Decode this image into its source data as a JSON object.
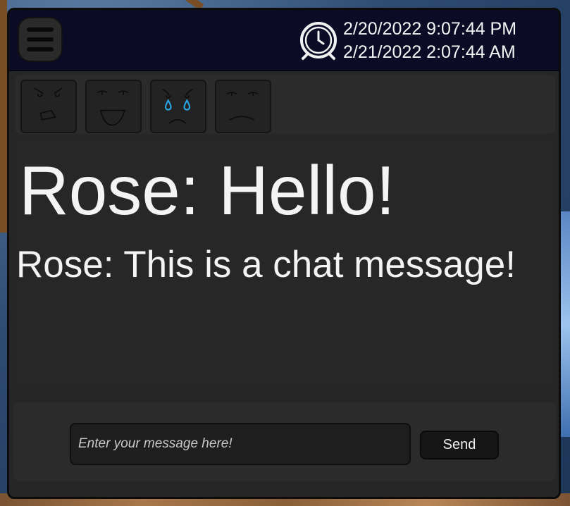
{
  "header": {
    "menu_icon": "hamburger-menu-icon",
    "clock_icon": "alarm-clock-icon",
    "datetime_primary": "2/20/2022 9:07:44 PM",
    "datetime_secondary": "2/21/2022 2:07:44 AM",
    "background_color": "#0b0b26"
  },
  "emotes": [
    {
      "name": "angry",
      "icon": "angry-face-icon"
    },
    {
      "name": "happy",
      "icon": "happy-face-icon"
    },
    {
      "name": "crying",
      "icon": "crying-face-icon",
      "tear_color": "#2aa7e6"
    },
    {
      "name": "sad",
      "icon": "sad-face-icon"
    }
  ],
  "chat_log": {
    "messages": [
      {
        "text": "Rose: Hello!",
        "size": "large"
      },
      {
        "text": "Rose: This is a chat message!",
        "size": "normal"
      }
    ]
  },
  "composer": {
    "placeholder": "Enter your message here!",
    "value": "",
    "send_label": "Send"
  }
}
